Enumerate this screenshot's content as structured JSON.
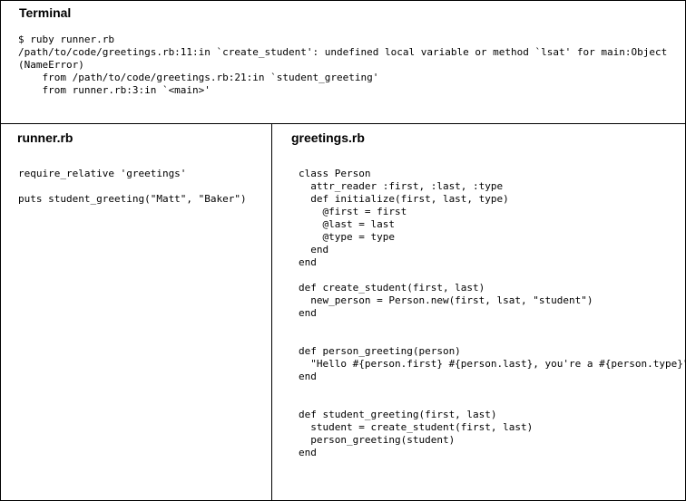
{
  "terminal": {
    "title": "Terminal",
    "lines": [
      "$ ruby runner.rb",
      "/path/to/code/greetings.rb:11:in `create_student': undefined local variable or method `lsat' for main:Object",
      "(NameError)",
      "    from /path/to/code/greetings.rb:21:in `student_greeting'",
      "    from runner.rb:3:in `<main>'"
    ]
  },
  "runner": {
    "title": "runner.rb",
    "lines": [
      "require_relative 'greetings'",
      "",
      "puts student_greeting(\"Matt\", \"Baker\")"
    ]
  },
  "greetings": {
    "title": "greetings.rb",
    "lines": [
      "class Person",
      "  attr_reader :first, :last, :type",
      "  def initialize(first, last, type)",
      "    @first = first",
      "    @last = last",
      "    @type = type",
      "  end",
      "end",
      "",
      "def create_student(first, last)",
      "  new_person = Person.new(first, lsat, \"student\")",
      "end",
      "",
      "",
      "def person_greeting(person)",
      "  \"Hello #{person.first} #{person.last}, you're a #{person.type}\"",
      "end",
      "",
      "",
      "def student_greeting(first, last)",
      "  student = create_student(first, last)",
      "  person_greeting(student)",
      "end"
    ]
  }
}
